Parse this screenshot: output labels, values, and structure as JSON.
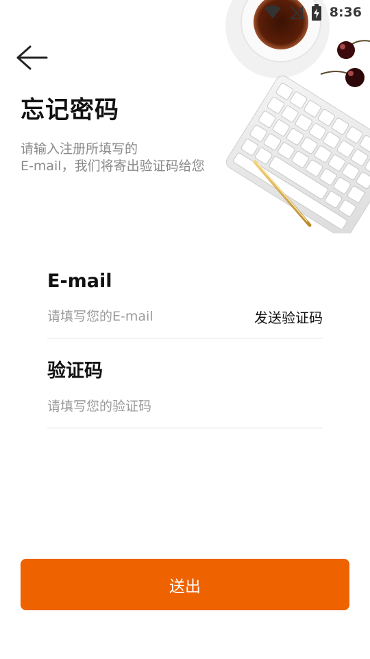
{
  "status_bar": {
    "time": "8:36",
    "icons": [
      "wifi-icon",
      "no-signal-icon",
      "battery-charging-icon"
    ]
  },
  "header": {
    "back_icon": "back-arrow-icon",
    "title": "忘记密码",
    "subtitle_line1": "请输入注册所填写的",
    "subtitle_line2": "E-mail，我们将寄出验证码给您"
  },
  "form": {
    "email": {
      "label": "E-mail",
      "placeholder": "请填写您的E-mail",
      "value": "",
      "send_code_label": "发送验证码"
    },
    "code": {
      "label": "验证码",
      "placeholder": "请填写您的验证码",
      "value": ""
    }
  },
  "submit": {
    "label": "送出"
  },
  "colors": {
    "accent": "#ee6200",
    "text_primary": "#111111",
    "text_secondary": "#8a8a8a",
    "divider": "#dddddd"
  }
}
